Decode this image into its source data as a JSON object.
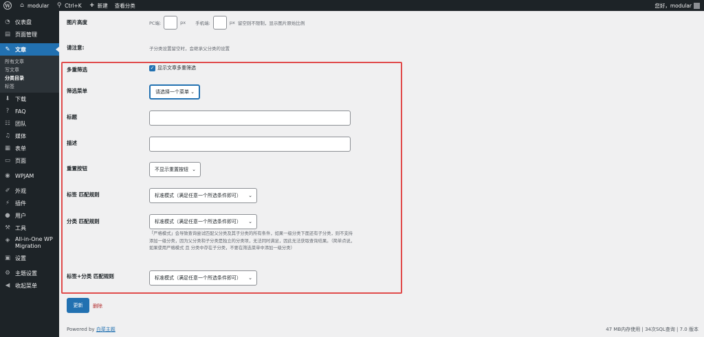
{
  "adminbar": {
    "site_name": "modular",
    "search_shortcut": "Ctrl+K",
    "new_label": "新建",
    "view_label": "查看分类",
    "greeting": "您好，modular"
  },
  "sidebar": {
    "dashboard": "仪表盘",
    "page_manage": "页面管理",
    "posts": "文章",
    "sub": [
      "所有文章",
      "写文章",
      "分类目录",
      "标签"
    ],
    "download": "下载",
    "faq": "FAQ",
    "team": "团队",
    "media": "媒体",
    "forms": "表单",
    "pages": "页面",
    "wpjam": "WPJAM",
    "appearance": "外观",
    "plugins": "插件",
    "users": "用户",
    "tools": "工具",
    "migration": "All-in-One WP Migration",
    "settings": "设置",
    "theme_settings": "主题设置",
    "collapse": "收起菜单"
  },
  "form": {
    "image_height_label": "图片高度",
    "pc_label": "PC端:",
    "px1": "px",
    "mobile_label": "手机端:",
    "px2": "px",
    "image_hint": "留空则不限制，显示图片原始比例",
    "notice_label": "请注意:",
    "notice_text": "子分类设置留空时，会继承父分类的设置",
    "multi_filter_label": "多重筛选",
    "multi_filter_checkbox": "显示文章多重筛选",
    "filter_menu_label": "筛选菜单",
    "filter_menu_value": "请选择一个菜单",
    "title_label": "标题",
    "desc_label": "描述",
    "reset_label": "重置按钮",
    "reset_value": "不显示重置按钮",
    "tag_match_label": "标签 匹配规则",
    "tag_match_value": "标准模式（满足任意一个所选条件即可）",
    "cat_match_label": "分类 匹配规则",
    "cat_match_value": "标准模式（满足任意一个所选条件即可）",
    "cat_match_desc": "「严格模式」会导致查询尝试匹配父分类及其子分类的所有条件，如果一级分类下面还有子分类，则不支持添加一级分类，因为父分类和子分类是独立的分类项，无法同时满足，因此无法获取查询结果。（简单点说，如果使用严格模式 且 分类中存在子分类，不要在筛选菜单中添加一级分类）",
    "tagcat_match_label": "标签+分类 匹配规则",
    "tagcat_match_value": "标准模式（满足任意一个所选条件即可）",
    "update_button": "更新",
    "delete_link": "删除"
  },
  "footer": {
    "powered_by": "Powered by",
    "theme_link": "白菜主题",
    "stats": "47 MB内存使用 | 34次SQL查询 | 7.0 版本"
  },
  "colors": {
    "admin_dark": "#1d2327",
    "accent_blue": "#2271b1",
    "highlight_red": "#e04a4a"
  }
}
